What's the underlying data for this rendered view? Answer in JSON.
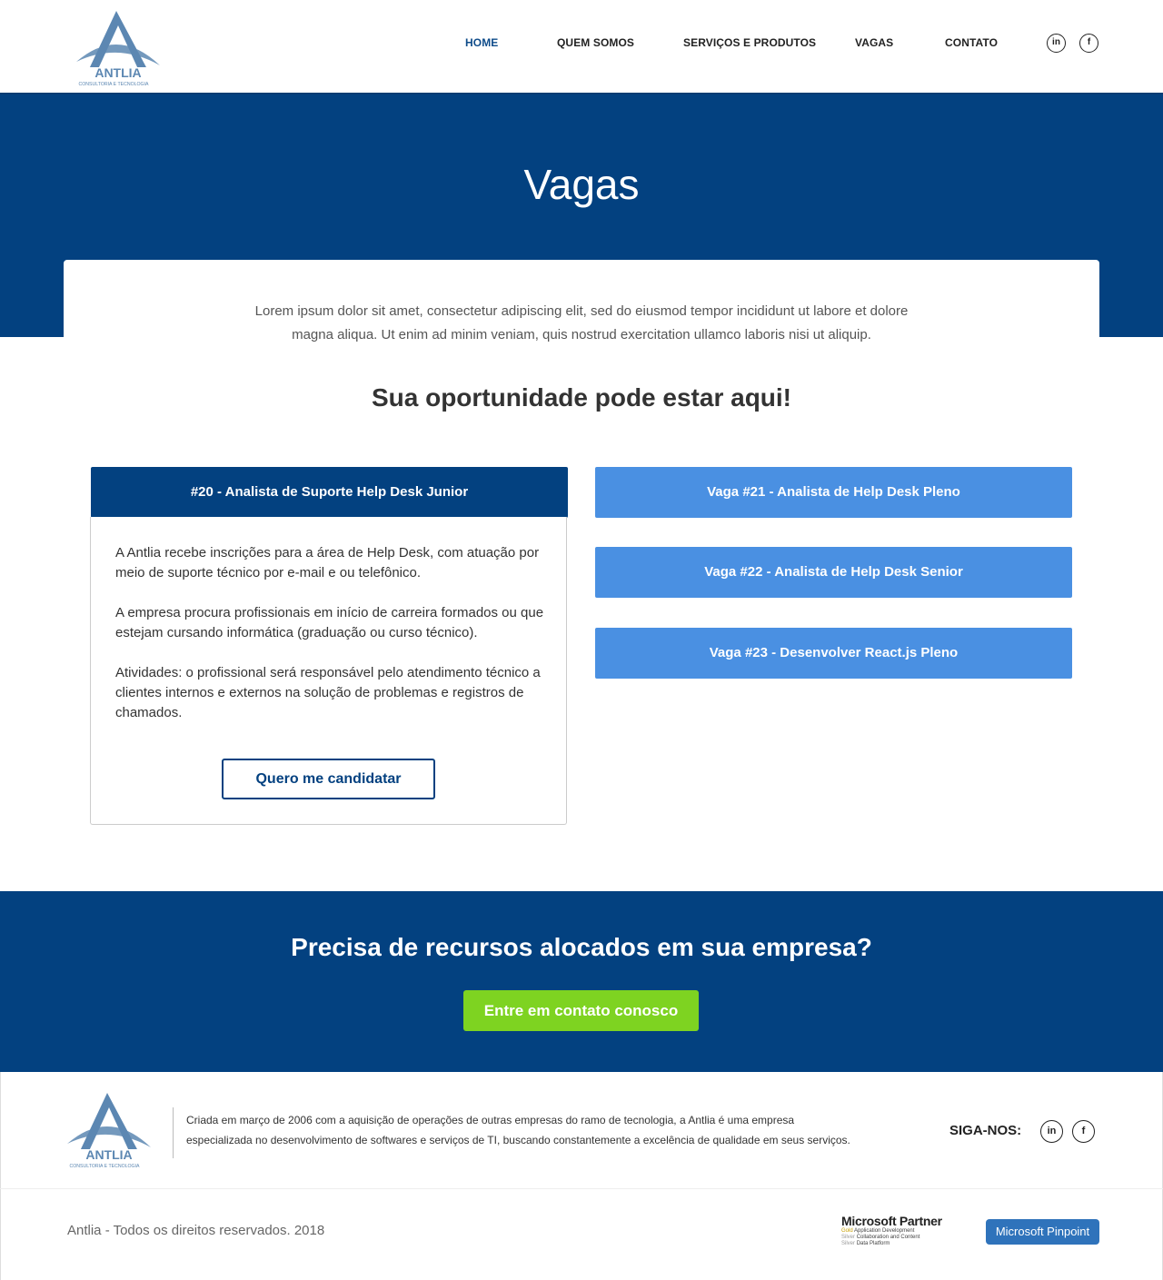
{
  "header": {
    "logo_text": "ANTLIA",
    "logo_tagline": "CONSULTORIA E TECNOLOGIA",
    "nav": [
      {
        "label": "HOME",
        "active": true
      },
      {
        "label": "QUEM SOMOS",
        "active": false
      },
      {
        "label": "SERVIÇOS E PRODUTOS",
        "active": false
      },
      {
        "label": "VAGAS",
        "active": false
      },
      {
        "label": "CONTATO",
        "active": false
      }
    ],
    "social": [
      {
        "icon": "linkedin-icon",
        "glyph": "in"
      },
      {
        "icon": "facebook-icon",
        "glyph": "f"
      }
    ]
  },
  "hero": {
    "title": "Vagas",
    "intro_line1": "Lorem ipsum dolor sit amet, consectetur adipiscing elit, sed do eiusmod tempor incididunt ut labore et dolore",
    "intro_line2": "magna aliqua. Ut enim ad minim veniam, quis nostrud exercitation ullamco laboris nisi ut aliquip."
  },
  "jobs": {
    "section_title": "Sua oportunidade pode estar aqui!",
    "open": {
      "title": "#20 - Analista de Suporte Help Desk Junior",
      "paragraphs": [
        "A Antlia recebe inscrições para a área de Help Desk, com atuação por meio de suporte técnico por e-mail e ou telefônico.",
        "A empresa procura profissionais em início de carreira formados ou que estejam cursando informática (graduação ou curso técnico).",
        "Atividades: o profissional será responsável pelo atendimento técnico a clientes internos e externos na solução de problemas e registros de chamados."
      ],
      "apply_label": "Quero me candidatar"
    },
    "others": [
      {
        "title": "Vaga #21 - Analista de Help Desk Pleno"
      },
      {
        "title": "Vaga #22 - Analista de Help Desk Senior"
      },
      {
        "title": "Vaga #23 - Desenvolver React.js Pleno"
      }
    ]
  },
  "cta": {
    "title": "Precisa de recursos alocados em sua empresa?",
    "button": "Entre em contato conosco"
  },
  "footer": {
    "about_line1": "Criada em março de 2006 com a aquisição de operações de outras empresas do ramo de tecnologia, a Antlia é uma empresa",
    "about_line2": "especializada no desenvolvimento de softwares e serviços de TI, buscando constantemente a excelência de qualidade em seus serviços.",
    "follow_label": "SIGA-NOS:",
    "copyright": "Antlia - Todos os direitos reservados. 2018",
    "ms_partner": {
      "title": "Microsoft Partner",
      "lines": [
        {
          "level": "Gold",
          "text": "Application Development"
        },
        {
          "level": "Silver",
          "text": "Collaboration and Content"
        },
        {
          "level": "Silver",
          "text": "Data Platform"
        }
      ]
    },
    "ms_pinpoint": "Microsoft Pinpoint"
  },
  "colors": {
    "brand_dark_blue": "#034180",
    "job_button_blue": "#4a90e2",
    "cta_green": "#7ed321",
    "logo_blue": "#5c87b2"
  }
}
